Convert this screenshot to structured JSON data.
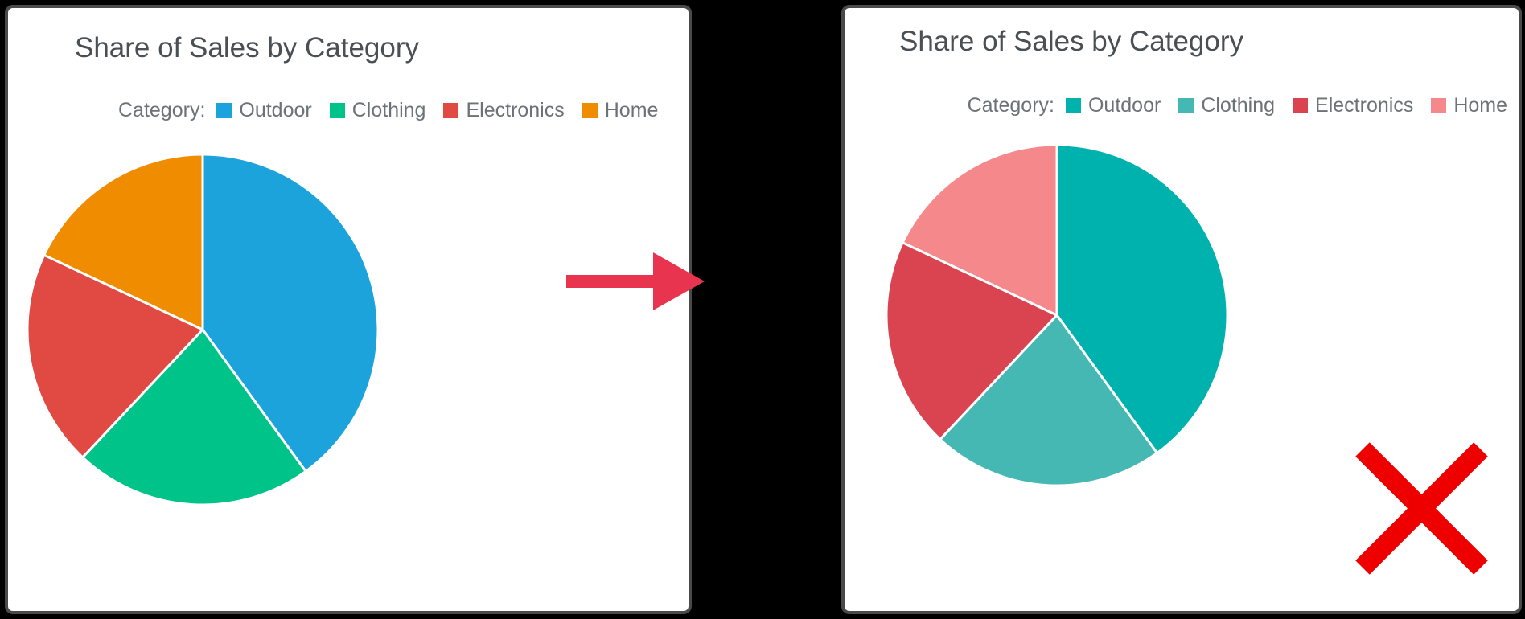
{
  "background_color": "#000000",
  "panel_border_color": "#4a4a4a",
  "panel_background": "#ffffff",
  "left_panel": {
    "title": "Share of Sales by Category",
    "legend_title": "Category:",
    "legend": [
      {
        "label": "Outdoor",
        "color": "#1ca3dc"
      },
      {
        "label": "Clothing",
        "color": "#00c389"
      },
      {
        "label": "Electronics",
        "color": "#e04a42"
      },
      {
        "label": "Home",
        "color": "#f08c00"
      }
    ]
  },
  "right_panel": {
    "title": "Share of Sales by Category",
    "legend_title": "Category:",
    "legend": [
      {
        "label": "Outdoor",
        "color": "#00b2ae"
      },
      {
        "label": "Clothing",
        "color": "#45b8b3"
      },
      {
        "label": "Electronics",
        "color": "#d94450"
      },
      {
        "label": "Home",
        "color": "#f4888b"
      }
    ]
  },
  "annotations": {
    "arrow_color": "#e8344e",
    "reject_mark_color": "#ee0000",
    "reject_mark_name": "red-x-cross"
  },
  "chart_data": [
    {
      "type": "pie",
      "id": "left-pie",
      "title": "Share of Sales by Category",
      "legend_title": "Category:",
      "legend_position": "top",
      "start_angle_deg": 0,
      "direction": "clockwise",
      "categories": [
        "Outdoor",
        "Clothing",
        "Electronics",
        "Home"
      ],
      "values": [
        40,
        22,
        20,
        18
      ],
      "unit": "percent",
      "colors": [
        "#1ca3dc",
        "#00c389",
        "#e04a42",
        "#f08c00"
      ],
      "slice_border_color": "#ffffff",
      "center": [
        240,
        400
      ],
      "radius": 215
    },
    {
      "type": "pie",
      "id": "right-pie",
      "title": "Share of Sales by Category",
      "legend_title": "Category:",
      "legend_position": "top",
      "start_angle_deg": 0,
      "direction": "clockwise",
      "categories": [
        "Outdoor",
        "Clothing",
        "Electronics",
        "Home"
      ],
      "values": [
        40,
        22,
        20,
        18
      ],
      "unit": "percent",
      "colors": [
        "#00b2ae",
        "#45b8b3",
        "#d94450",
        "#f4888b"
      ],
      "slice_border_color": "#ffffff",
      "center": [
        1100,
        385
      ],
      "radius": 212
    }
  ]
}
